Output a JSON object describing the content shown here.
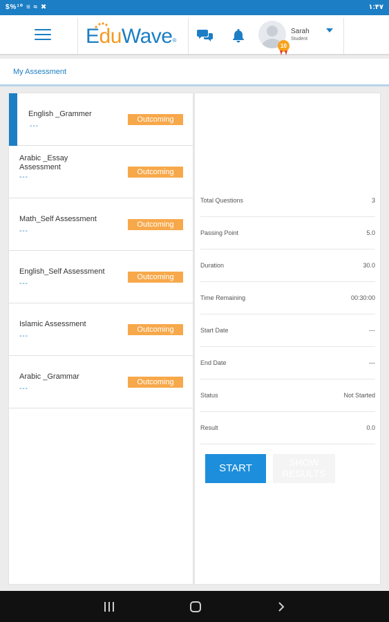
{
  "status_bar": {
    "left_icons": "$%¹⁰ ≡ ≈ ✖",
    "time": "۱:۴۷"
  },
  "app": {
    "logo": {
      "e": "E",
      "du": "du",
      "wave": "Wave",
      "reg": "®"
    },
    "user": {
      "name": "Sarah",
      "role": "Student",
      "badge": "10"
    }
  },
  "breadcrumb": {
    "label": "My Assessment"
  },
  "assessments": [
    {
      "title": "English _Grammer",
      "dash": "---",
      "status": "Outcoming"
    },
    {
      "title": "Arabic _Essay Assessment",
      "dash": "---",
      "status": "Outcoming"
    },
    {
      "title": "Math_Self Assessment",
      "dash": "---",
      "status": "Outcoming"
    },
    {
      "title": "English_Self Assessment",
      "dash": "---",
      "status": "Outcoming"
    },
    {
      "title": "Islamic Assessment",
      "dash": "---",
      "status": "Outcoming"
    },
    {
      "title": "Arabic _Grammar",
      "dash": "---",
      "status": "Outcoming"
    }
  ],
  "details": [
    {
      "label": "Total Questions",
      "value": "3"
    },
    {
      "label": "Passing Point",
      "value": "5.0"
    },
    {
      "label": "Duration",
      "value": "30.0"
    },
    {
      "label": "Time Remaining",
      "value": "00:30:00"
    },
    {
      "label": "Start Date",
      "value": "---"
    },
    {
      "label": "End Date",
      "value": "---"
    },
    {
      "label": "Status",
      "value": "Not Started"
    },
    {
      "label": "Result",
      "value": "0.0"
    }
  ],
  "buttons": {
    "start": "START",
    "show_results_line1": "SHOW",
    "show_results_line2": "RESULTS"
  },
  "icons": {
    "menu": "hamburger-menu-icon",
    "chat": "chat-bubbles-icon",
    "notifications": "bell-icon",
    "user_menu": "caret-down-icon",
    "nav_recents": "recents-icon",
    "nav_home": "home-icon",
    "nav_back": "back-chevron-icon"
  },
  "colors": {
    "primary": "#1c7ec4",
    "accent_orange": "#f39a1f",
    "status_pill": "#f7a84a",
    "start_button": "#1c8edb"
  }
}
